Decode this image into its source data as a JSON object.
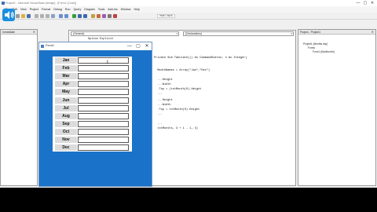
{
  "window": {
    "title": "Project1 - Microsoft Visual Basic [design] - [Form1 (Code)]",
    "min_glyph": "—",
    "max_glyph": "▢",
    "close_glyph": "✕"
  },
  "menu": [
    "File",
    "Edit",
    "View",
    "Project",
    "Format",
    "Debug",
    "Run",
    "Query",
    "Diagram",
    "Tools",
    "Add-Ins",
    "Window",
    "Help"
  ],
  "toolbar": {
    "position_text": "7965 x 6915"
  },
  "immediate": {
    "title": "Immediate",
    "close_glyph": "✕"
  },
  "code_window": {
    "object_combo": "(General)",
    "proc_combo": "(Declarations)",
    "combo_arrow": "▾",
    "lines": [
      "Option Explicit",
      "",
      "Private Sub Tabulate(() As CommandButton, n As Integer)",
      "",
      "Dim MonthNames",
      "  MonthNames = Array(\"Jan\",\"Dec\")",
      "",
      "  ...Height",
      "  ...Width",
      "  .Top = (txtMonth(0).Height",
      "  ...",
      "",
      "  ...Height",
      "  ...Width",
      "  .Top = txtMonth(0).Height",
      "  ...",
      "",
      "",
      "  ...",
      "  txtMonths, 3 + i - 1, 3)",
      ""
    ]
  },
  "project": {
    "title": "Project - Project1",
    "close_glyph": "✕",
    "tree": [
      "Project1 (Months.vbp)",
      "Forms",
      "Form1 (Months.frm)"
    ]
  },
  "form": {
    "title": "Form1",
    "min_glyph": "—",
    "max_glyph": "▢",
    "close_glyph": "✕",
    "months": [
      "Jan",
      "Feb",
      "Mar",
      "Apr",
      "May",
      "Jun",
      "Jul",
      "Aug",
      "Sep",
      "Oct",
      "Nov",
      "Dec"
    ]
  },
  "cursor_glyph": "I",
  "colors": {
    "form_background": "#1a73c8",
    "speaker_icon": "#1b8fe0"
  }
}
